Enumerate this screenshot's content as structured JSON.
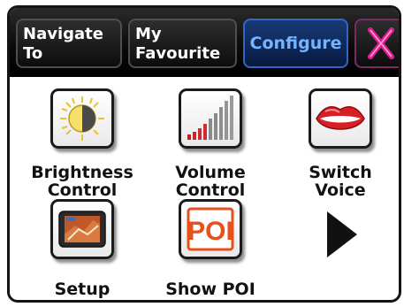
{
  "tabs": [
    {
      "label": "Navigate\nTo"
    },
    {
      "label": "My\nFavourite"
    },
    {
      "label": "Configure"
    }
  ],
  "close_icon": "close-x-icon",
  "items": [
    {
      "label": "Brightness\nControl",
      "icon": "brightness-icon"
    },
    {
      "label": "Volume\nControl",
      "icon": "volume-icon"
    },
    {
      "label": "Switch\nVoice",
      "icon": "lips-icon"
    },
    {
      "label": "Setup",
      "icon": "gps-device-icon"
    },
    {
      "label": "Show POI",
      "icon": "poi-icon",
      "icon_text": "POI"
    }
  ],
  "next_icon": "next-page-arrow-icon",
  "colors": {
    "active_tab_text": "#74b4ff",
    "close_x": "#d8208c",
    "poi": "#e8501a"
  }
}
